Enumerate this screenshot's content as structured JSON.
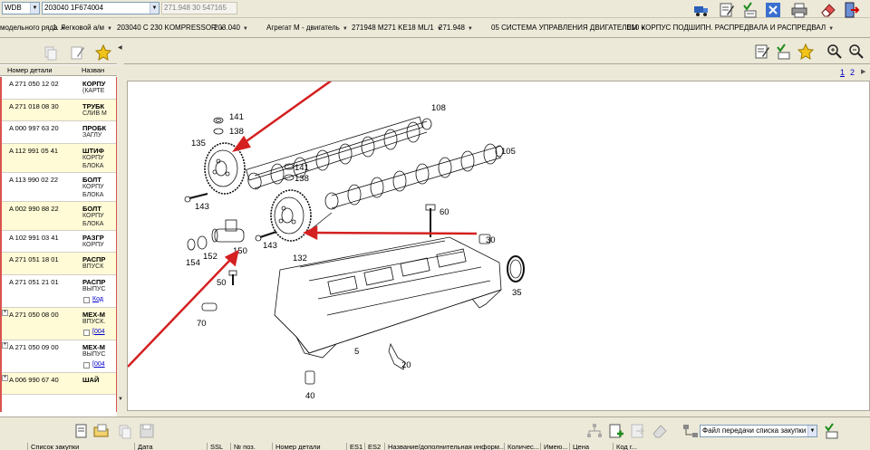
{
  "topbar": {
    "brand_combo": "WDB",
    "vin_combo": "203040 1F674004",
    "code_field": "271.948 30 547165"
  },
  "breadcrumbs": [
    {
      "label": "модельного ряда"
    },
    {
      "label": "1. Легковой а/м"
    },
    {
      "label": "203040 C 230 KOMPRESSOR"
    },
    {
      "label": "203.040"
    },
    {
      "label": "Агрегат M - двигатель"
    },
    {
      "label": "271948 M271 KE18 ML/1"
    },
    {
      "label": "271.948"
    },
    {
      "label": "05 СИСТЕМА УПРАВЛЕНИЯ ДВИГАТЕЛЕМ"
    },
    {
      "label": "010 КОРПУС ПОДШИПН. РАСПРЕДВАЛА И РАСПРЕДВАЛ"
    }
  ],
  "parts_list": {
    "col_part_no": "Номер детали",
    "col_name": "Назван",
    "rows": [
      {
        "part_no": "A 271 050 12 02",
        "name": "КОРПУ",
        "sub": "(КАРТЕ",
        "yellow": false,
        "plus": false
      },
      {
        "part_no": "A 271 018 08 30",
        "name": "ТРУБК",
        "sub": "СЛИВ М",
        "yellow": true,
        "plus": false
      },
      {
        "part_no": "A 000 997 63 20",
        "name": "ПРОБК",
        "sub": "ЗАГЛУ",
        "yellow": false,
        "plus": false
      },
      {
        "part_no": "A 112 991 05 41",
        "name": "ШТИФ",
        "sub": "КОРПУ",
        "sub2": "БЛОКА",
        "yellow": true,
        "plus": false
      },
      {
        "part_no": "A 113 990 02 22",
        "name": "БОЛТ",
        "sub": "КОРПУ",
        "sub2": "БЛОКА",
        "yellow": false,
        "plus": false
      },
      {
        "part_no": "A 002 990 88 22",
        "name": "БОЛТ",
        "sub": "КОРПУ",
        "sub2": "БЛОКА",
        "yellow": true,
        "plus": false
      },
      {
        "part_no": "A 102 991 03 41",
        "name": "РАЗГР",
        "sub": "КОРПУ",
        "yellow": false,
        "plus": false
      },
      {
        "part_no": "A 271 051 18 01",
        "name": "РАСПР",
        "sub": "ВПУСК",
        "yellow": true,
        "plus": false
      },
      {
        "part_no": "A 271 051 21 01",
        "name": "РАСПР",
        "sub": "ВЫПУС",
        "link": "Код",
        "yellow": false,
        "plus": false
      },
      {
        "part_no": "A 271 050 08 00",
        "name": "МЕХ-М",
        "sub": "ВПУСК.",
        "link": "[004",
        "yellow": true,
        "plus": true
      },
      {
        "part_no": "A 271 050 09 00",
        "name": "МЕХ-М",
        "sub": "ВЫПУС",
        "link": "[004",
        "yellow": false,
        "plus": true
      },
      {
        "part_no": "A 006 990 67 40",
        "name": "ШАЙ",
        "sub": "",
        "yellow": true,
        "plus": true
      }
    ]
  },
  "pages": {
    "current": "1",
    "next": "2"
  },
  "diagram": {
    "callouts": [
      "108",
      "141",
      "138",
      "135",
      "105",
      "141",
      "138",
      "143",
      "60",
      "30",
      "143",
      "150",
      "152",
      "154",
      "132",
      "50",
      "35",
      "70",
      "5",
      "20",
      "40"
    ]
  },
  "bottom": {
    "transfer_combo": "Файл передачи списка закупки",
    "left_headers": [
      "Список закупки",
      "Дата"
    ],
    "right_headers": [
      "SSL",
      "№ поз.",
      "Номер детали",
      "ES1",
      "ES2",
      "Название/дополнительная информ...",
      "Количес...",
      "Имею...",
      "Цена",
      "Код г..."
    ]
  },
  "colors": {
    "accent_red": "#d9534f",
    "arrow_red": "#d42020",
    "link_blue": "#0000c0"
  }
}
